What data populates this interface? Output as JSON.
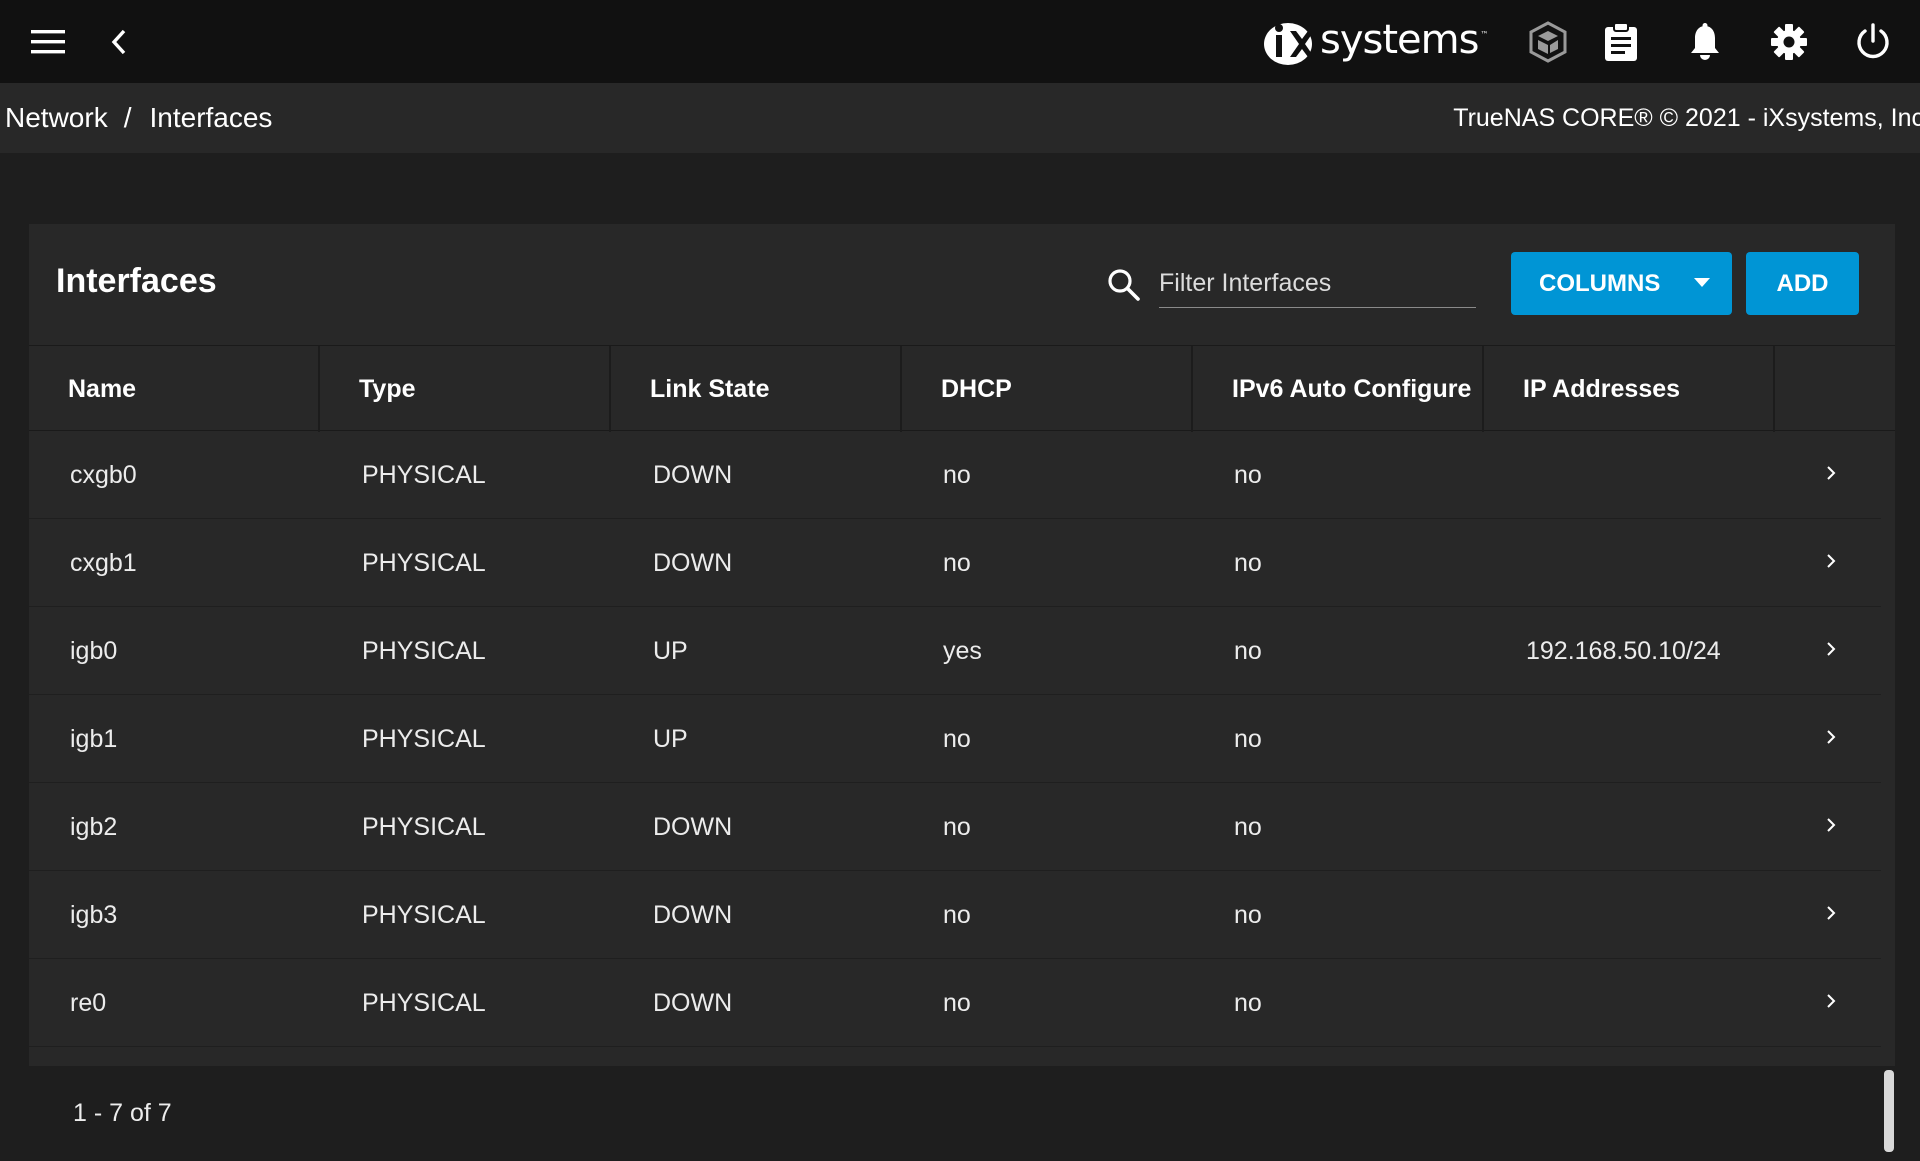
{
  "topbar": {
    "menu_icon": "menu-icon",
    "back_icon": "chevron-left-icon",
    "logo_text": "systems",
    "logo_tm": "™",
    "icons": [
      "truecommand-icon",
      "clipboard-icon",
      "bell-icon",
      "gear-icon",
      "power-icon"
    ]
  },
  "breadcrumb": {
    "items": [
      "Network",
      "Interfaces"
    ],
    "separator": "/"
  },
  "copyright": "TrueNAS CORE® © 2021 - iXsystems, Inc",
  "card": {
    "title": "Interfaces",
    "filter_placeholder": "Filter Interfaces",
    "filter_value": "",
    "columns_label": "COLUMNS",
    "add_label": "ADD"
  },
  "table": {
    "headers": [
      "Name",
      "Type",
      "Link State",
      "DHCP",
      "IPv6 Auto Configure",
      "IP Addresses"
    ],
    "rows": [
      {
        "name": "cxgb0",
        "type": "PHYSICAL",
        "link": "DOWN",
        "dhcp": "no",
        "ipv6": "no",
        "ip": ""
      },
      {
        "name": "cxgb1",
        "type": "PHYSICAL",
        "link": "DOWN",
        "dhcp": "no",
        "ipv6": "no",
        "ip": ""
      },
      {
        "name": "igb0",
        "type": "PHYSICAL",
        "link": "UP",
        "dhcp": "yes",
        "ipv6": "no",
        "ip": "192.168.50.10/24"
      },
      {
        "name": "igb1",
        "type": "PHYSICAL",
        "link": "UP",
        "dhcp": "no",
        "ipv6": "no",
        "ip": ""
      },
      {
        "name": "igb2",
        "type": "PHYSICAL",
        "link": "DOWN",
        "dhcp": "no",
        "ipv6": "no",
        "ip": ""
      },
      {
        "name": "igb3",
        "type": "PHYSICAL",
        "link": "DOWN",
        "dhcp": "no",
        "ipv6": "no",
        "ip": ""
      },
      {
        "name": "re0",
        "type": "PHYSICAL",
        "link": "DOWN",
        "dhcp": "no",
        "ipv6": "no",
        "ip": ""
      }
    ]
  },
  "pagination": "1 - 7 of 7",
  "colors": {
    "accent": "#0095d5",
    "topbar": "#111111",
    "card": "#282828",
    "background": "#1e1e1e"
  }
}
